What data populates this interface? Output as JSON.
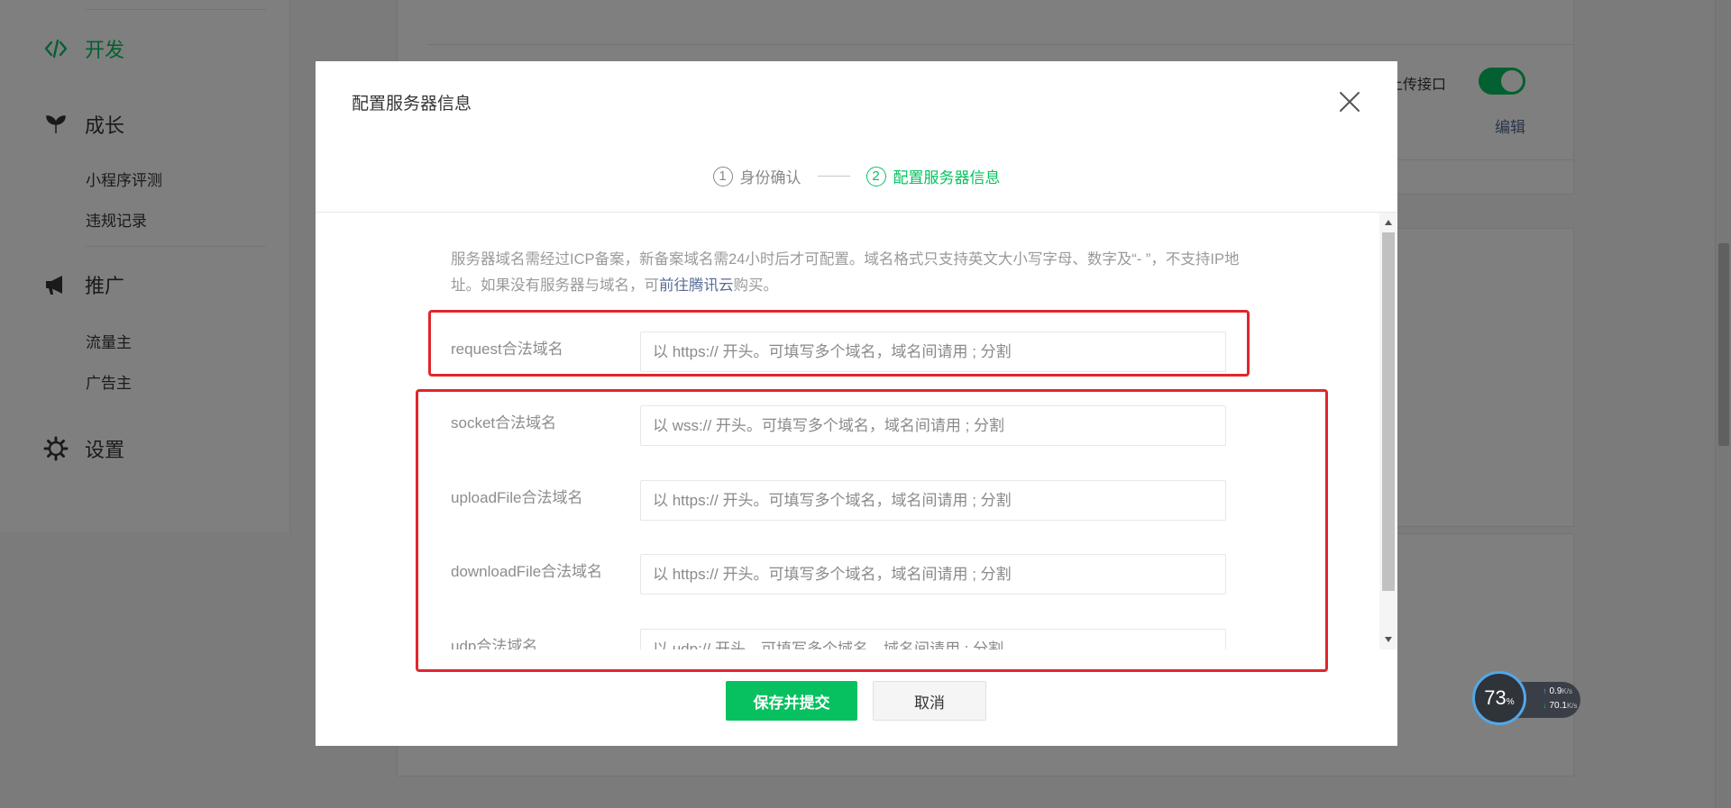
{
  "sidebar": {
    "groups": [
      {
        "label": "开发",
        "icon": "code-icon"
      },
      {
        "label": "成长",
        "icon": "leaf-icon"
      },
      {
        "label": "推广",
        "icon": "megaphone-icon"
      },
      {
        "label": "设置",
        "icon": "gear-icon"
      }
    ],
    "sub_items": [
      "小程序评测",
      "违规记录",
      "流量主",
      "广告主"
    ]
  },
  "background": {
    "upload_label_partial": "上传接口",
    "edit_link": "编辑"
  },
  "dialog": {
    "title": "配置服务器信息",
    "steps": [
      {
        "num": "1",
        "label": "身份确认"
      },
      {
        "num": "2",
        "label": "配置服务器信息"
      }
    ],
    "intro": "服务器域名需经过ICP备案，新备案域名需24小时后才可配置。域名格式只支持英文大小写字母、数字及“- ”，不支持IP地址。如果没有服务器与域名，可",
    "intro_link": "前往腾讯云",
    "intro_suffix": "购买。",
    "fields": [
      {
        "label": "request合法域名",
        "placeholder": "以 https:// 开头。可填写多个域名，域名间请用 ; 分割"
      },
      {
        "label": "socket合法域名",
        "placeholder": "以 wss:// 开头。可填写多个域名，域名间请用 ; 分割"
      },
      {
        "label": "uploadFile合法域名",
        "placeholder": "以 https:// 开头。可填写多个域名，域名间请用 ; 分割"
      },
      {
        "label": "downloadFile合法域名",
        "placeholder": "以 https:// 开头。可填写多个域名，域名间请用 ; 分割"
      },
      {
        "label": "udp合法域名",
        "placeholder": "以 udp:// 开头。可填写多个域名，域名间请用 ; 分割"
      }
    ],
    "save_label": "保存并提交",
    "cancel_label": "取消"
  },
  "widget": {
    "percent": "73",
    "percent_unit": "%",
    "upload_speed": "0.9",
    "download_speed": "70.1",
    "speed_unit": "K/s"
  },
  "colors": {
    "accent": "#07c160",
    "link": "#576b95",
    "highlight_box": "#e0262c"
  }
}
